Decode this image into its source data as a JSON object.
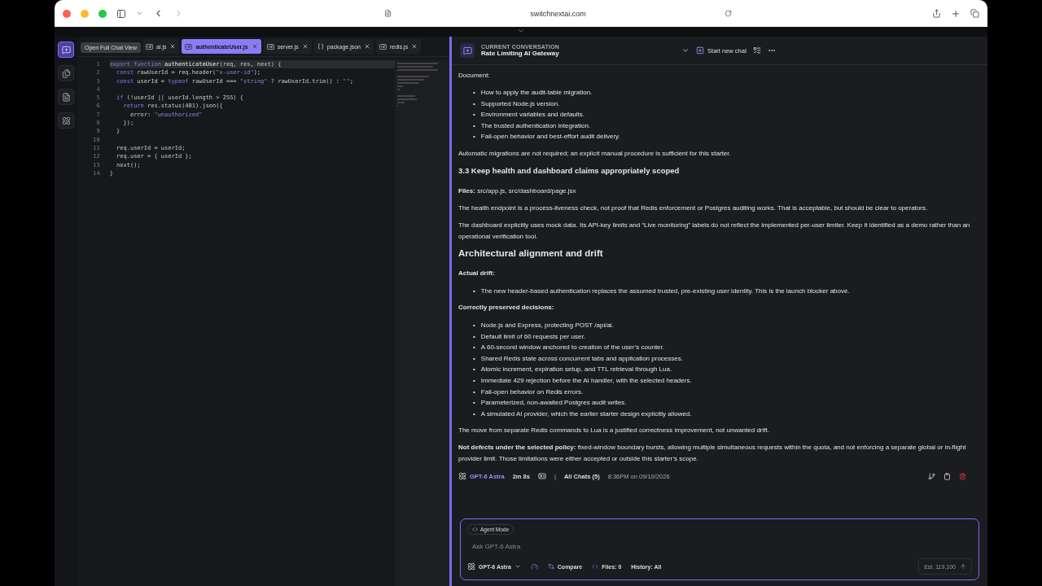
{
  "browser": {
    "url": "switchnextai.com"
  },
  "rail": {
    "tooltip": "Open Full Chat View"
  },
  "tabs": [
    {
      "label": "ai.js",
      "kind": "script",
      "selected": false
    },
    {
      "label": "authenticateUser.js",
      "kind": "script",
      "selected": true
    },
    {
      "label": "server.js",
      "kind": "script",
      "selected": false
    },
    {
      "label": "package.json",
      "kind": "json",
      "selected": false
    },
    {
      "label": "redis.js",
      "kind": "script",
      "selected": false
    }
  ],
  "code": [
    {
      "n": "1",
      "tokens": [
        {
          "t": "export function ",
          "kind": "kw"
        },
        {
          "t": "authenticateUser",
          "kind": "fn"
        },
        {
          "t": "(req, res, next) {",
          "kind": "plain"
        }
      ]
    },
    {
      "n": "2",
      "tokens": [
        {
          "t": "  const ",
          "kind": "kw"
        },
        {
          "t": "rawUserId = req.header(",
          "kind": "plain"
        },
        {
          "t": "\"x-user-id\"",
          "kind": "str"
        },
        {
          "t": ");",
          "kind": "plain"
        }
      ]
    },
    {
      "n": "3",
      "tokens": [
        {
          "t": "  const ",
          "kind": "kw"
        },
        {
          "t": "userId = ",
          "kind": "plain"
        },
        {
          "t": "typeof ",
          "kind": "kw"
        },
        {
          "t": "rawUserId === ",
          "kind": "plain"
        },
        {
          "t": "\"string\"",
          "kind": "str"
        },
        {
          "t": " ? rawUserId.trim() : ",
          "kind": "plain"
        },
        {
          "t": "\"\"",
          "kind": "str"
        },
        {
          "t": ";",
          "kind": "plain"
        }
      ]
    },
    {
      "n": "4"
    },
    {
      "n": "5",
      "tokens": [
        {
          "t": "  if ",
          "kind": "kw"
        },
        {
          "t": "(!userId || userId.length > 255) {",
          "kind": "plain"
        }
      ]
    },
    {
      "n": "6",
      "tokens": [
        {
          "t": "    return ",
          "kind": "kw"
        },
        {
          "t": "res.status(401).json({",
          "kind": "plain"
        }
      ]
    },
    {
      "n": "7",
      "tokens": [
        {
          "t": "      error: ",
          "kind": "plain"
        },
        {
          "t": "\"unauthorized\"",
          "kind": "str"
        }
      ]
    },
    {
      "n": "8",
      "tokens": [
        {
          "t": "    });",
          "kind": "plain"
        }
      ]
    },
    {
      "n": "9",
      "tokens": [
        {
          "t": "  }",
          "kind": "plain"
        }
      ]
    },
    {
      "n": "10"
    },
    {
      "n": "11",
      "tokens": [
        {
          "t": "  req.userId = userId;",
          "kind": "plain"
        }
      ]
    },
    {
      "n": "12",
      "tokens": [
        {
          "t": "  req.user = { userId };",
          "kind": "plain"
        }
      ]
    },
    {
      "n": "13",
      "tokens": [
        {
          "t": "  next();",
          "kind": "plain"
        }
      ]
    },
    {
      "n": "14",
      "tokens": [
        {
          "t": "}",
          "kind": "plain"
        }
      ]
    }
  ],
  "chat_header": {
    "caption": "CURRENT CONVERSATION",
    "title": "Rate Limiting AI Gateway",
    "new_chat": "Start new chat"
  },
  "messages": [
    {
      "kind": "p",
      "text": "Document:"
    },
    {
      "kind": "ul",
      "marker": "•",
      "items": [
        "How to apply the audit-table migration.",
        "Supported Node.js version.",
        "Environment variables and defaults.",
        "The trusted authentication integration.",
        "Fail-open behavior and best-effort audit delivery."
      ]
    },
    {
      "kind": "p",
      "text": "Automatic migrations are not required; an explicit manual procedure is sufficient for this starter."
    },
    {
      "kind": "h3",
      "text": "3.3 Keep health and dashboard claims appropriately scoped"
    },
    {
      "kind": "p",
      "text": "**Files:** src/app.js, src/dashboard/page.jsx"
    },
    {
      "kind": "p",
      "text": "The health endpoint is a process-liveness check, not proof that Redis enforcement or Postgres auditing works. That is acceptable, but should be clear to operators."
    },
    {
      "kind": "p",
      "text": "The dashboard explicitly uses mock data. Its API-key limits and “Live monitoring” labels do not reflect the implemented per-user limiter. Keep it identified as a demo rather than an operational verification tool."
    },
    {
      "kind": "h2",
      "text": "Architectural alignment and drift"
    },
    {
      "kind": "label",
      "text": "Actual drift:"
    },
    {
      "kind": "ul",
      "marker": "•",
      "items": [
        "The new header-based authentication replaces the assumed trusted, pre-existing user identity. This is the launch blocker above."
      ]
    },
    {
      "kind": "label",
      "text": "Correctly preserved decisions:"
    },
    {
      "kind": "ul",
      "marker": "•",
      "items": [
        "Node.js and Express, protecting POST /api/ai.",
        "Default limit of 60 requests per user.",
        "A 60-second window anchored to creation of the user’s counter.",
        "Shared Redis state across concurrent tabs and application processes.",
        "Atomic increment, expiration setup, and TTL retrieval through Lua.",
        "Immediate 429 rejection before the AI handler, with the selected headers.",
        "Fail-open behavior on Redis errors.",
        "Parameterized, non-awaited Postgres audit writes.",
        "A simulated AI provider, which the earlier starter design explicitly allowed."
      ]
    },
    {
      "kind": "p",
      "text": "The move from separate Redis commands to Lua is a justified correctness improvement, not unwanted drift."
    },
    {
      "kind": "p",
      "text": "**Not defects under the selected policy:** fixed-window boundary bursts, allowing multiple simultaneous requests within the quota, and not enforcing a separate global or in-flight provider limit. Those limitations were either accepted or outside this starter’s scope."
    }
  ],
  "meta": {
    "model": "GPT-6 Astra",
    "duration": "2m 8s",
    "separator": "|",
    "chats": "All Chats (5)",
    "time": "8:36PM on 09/10/2026"
  },
  "composer": {
    "mode": "Agent Mode",
    "placeholder": "Ask GPT-6 Astra",
    "model": "GPT-6 Astra",
    "compare": "Compare",
    "files": "Files: 0",
    "history": "History: All",
    "estimate": "Est. 119,100"
  }
}
